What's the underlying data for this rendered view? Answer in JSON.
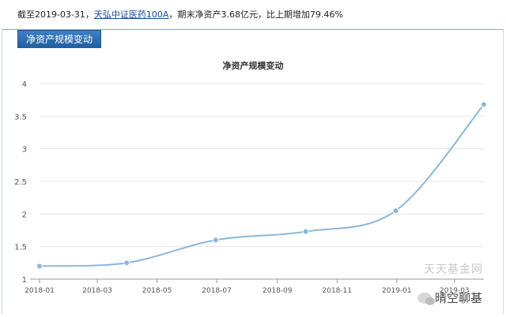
{
  "summary": {
    "prefix": "截至2019-03-31，",
    "fund_name": "天弘中证医药100A",
    "suffix": "，期末净资产3.68亿元，比上期增加79.46%"
  },
  "tab": {
    "label": "净资产规模变动"
  },
  "watermarks": {
    "site": "天天基金网",
    "wechat_account": "晴空聊基"
  },
  "colors": {
    "line": "#8ab7dd",
    "tab": "#2a6db5",
    "grid": "#e6e6e6"
  },
  "chart_data": {
    "type": "line",
    "title": "净资产规模变动",
    "xlabel": "",
    "ylabel": "",
    "ylim": [
      1,
      4
    ],
    "yticks": [
      "1",
      "1.5",
      "2",
      "2.5",
      "3",
      "3.5",
      "4"
    ],
    "x_range": [
      "2018-01-01",
      "2019-03-31"
    ],
    "xticks": [
      "2018-01",
      "2018-03",
      "2018-05",
      "2018-07",
      "2018-09",
      "2018-11",
      "2019-01",
      "2019-03"
    ],
    "grid": true,
    "legend": "none",
    "points": [
      {
        "x": "2018-01-01",
        "y": 1.2
      },
      {
        "x": "2018-03-31",
        "y": 1.25
      },
      {
        "x": "2018-06-30",
        "y": 1.6
      },
      {
        "x": "2018-09-30",
        "y": 1.73
      },
      {
        "x": "2018-12-31",
        "y": 2.05
      },
      {
        "x": "2019-03-31",
        "y": 3.68
      }
    ]
  }
}
